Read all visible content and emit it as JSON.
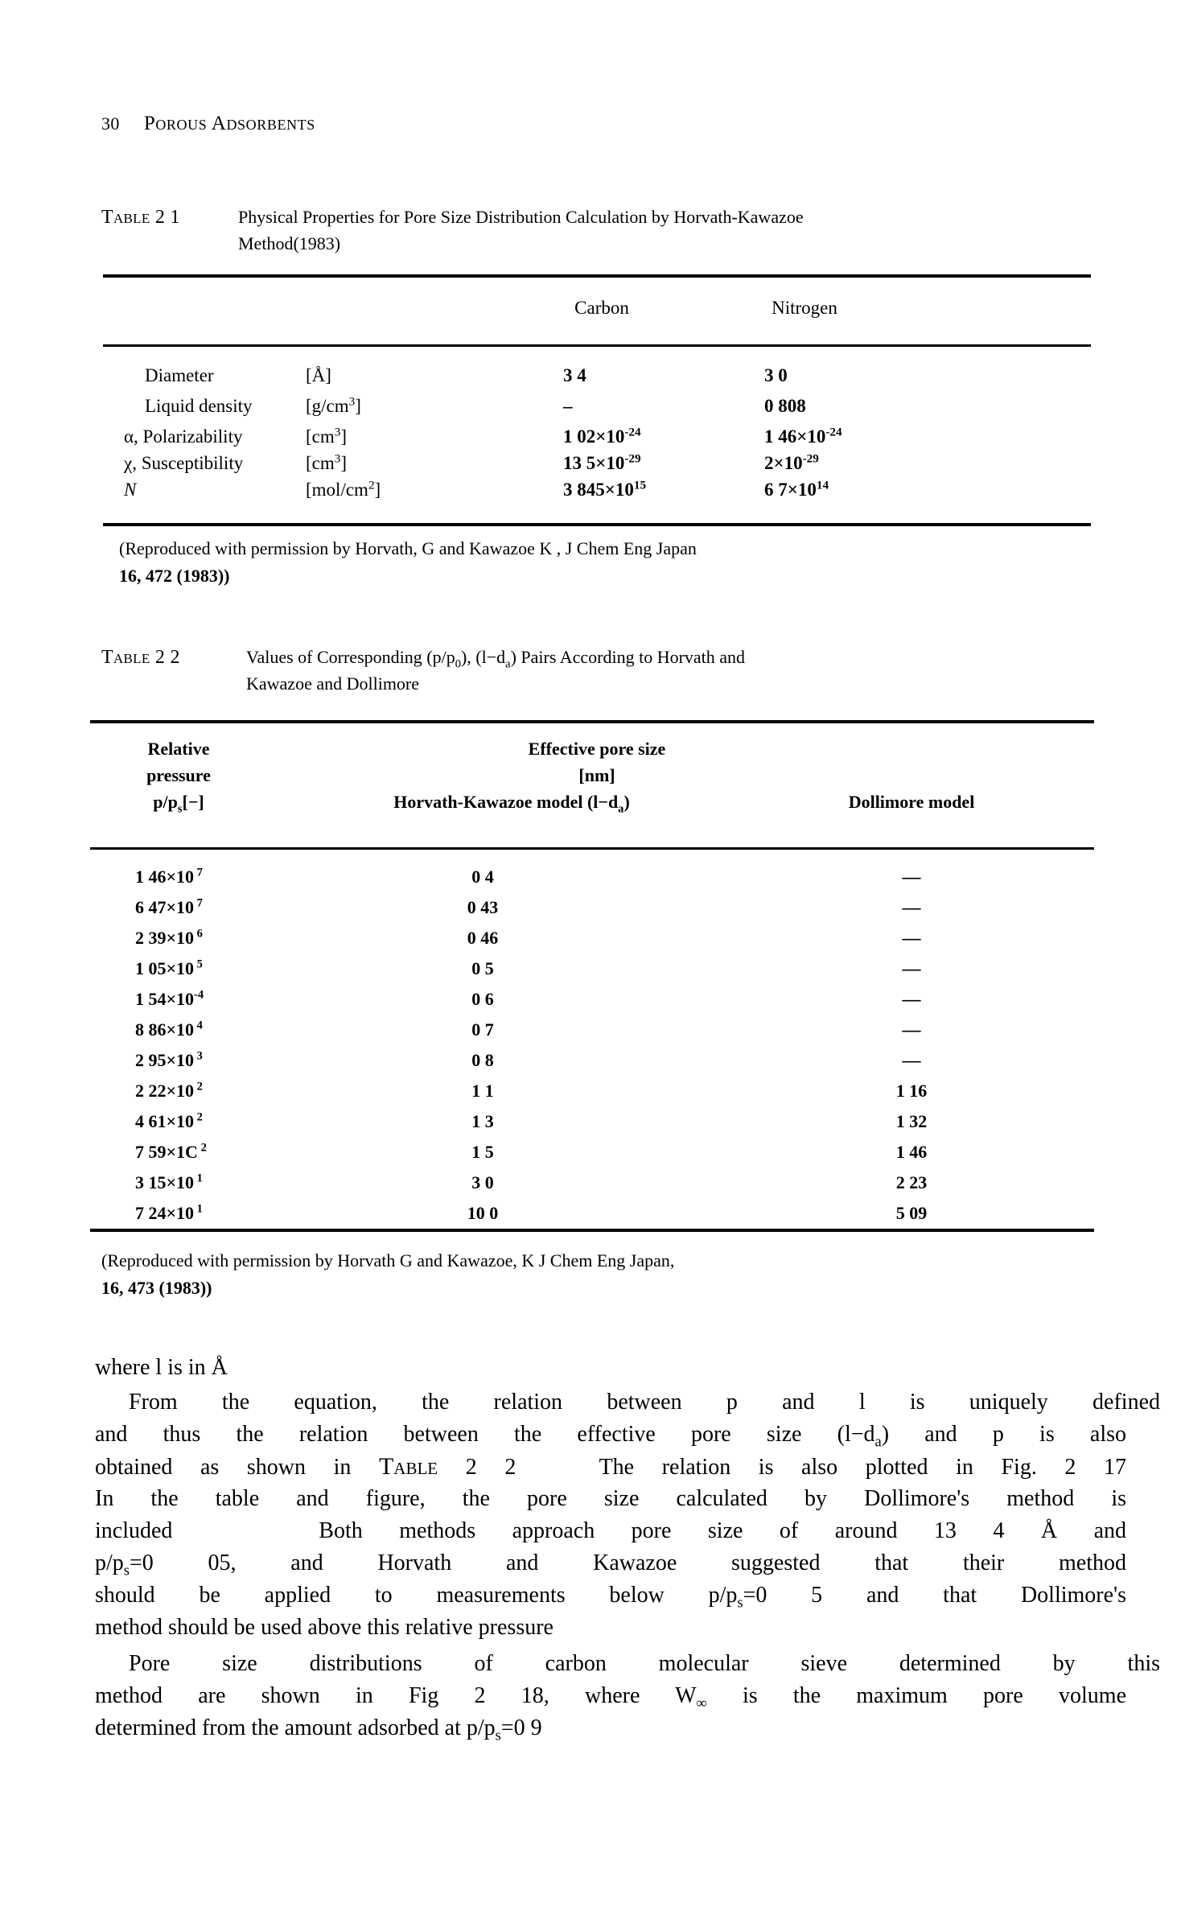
{
  "page": {
    "folio": "30",
    "running_head": "Porous Adsorbents"
  },
  "table21": {
    "caption_label": "Table 2 1",
    "caption_line1": "Physical Properties for Pore Size Distribution Calculation by Horvath-Kawazoe",
    "caption_line2": "Method(1983)",
    "columns": [
      "",
      "",
      "Carbon",
      "Nitrogen"
    ],
    "rows": [
      {
        "property": "Diameter",
        "unit": "[Å]",
        "carbon": "3 4",
        "carbon_exp": "",
        "nitrogen": "3 0",
        "nitrogen_exp": ""
      },
      {
        "property": "Liquid density",
        "unit": "[g/cm³]",
        "carbon": "–",
        "carbon_exp": "",
        "nitrogen": "0 808",
        "nitrogen_exp": ""
      },
      {
        "property": "α, Polarizability",
        "unit": "[cm³]",
        "carbon": "1 02×10",
        "carbon_exp": "-24",
        "nitrogen": "1 46×10",
        "nitrogen_exp": "-24"
      },
      {
        "property": "χ, Susceptibility",
        "unit": "[cm³]",
        "carbon": "13 5×10",
        "carbon_exp": "-29",
        "nitrogen": "2×10",
        "nitrogen_exp": "-29"
      },
      {
        "property": "N",
        "unit": "[mol/cm²]",
        "carbon": "3 845×10",
        "carbon_exp": "15",
        "nitrogen": "6 7×10",
        "nitrogen_exp": "14"
      }
    ],
    "source_note_line1": "(Reproduced with permission by Horvath, G  and Kawazoe K ,",
    "source_note_italic": "J  Chem  Eng  Japan",
    "source_note_line2": "16, 472 (1983))"
  },
  "table22": {
    "caption_label": "Table 2 2",
    "caption_line1_a": "Values of Corresponding (",
    "caption_line1_p": "p/p",
    "caption_line1_sub": "0",
    "caption_line1_b": "), (",
    "caption_line1_l": "l−d",
    "caption_line1_sub2": "a",
    "caption_line1_c": ") Pairs According to Horvath and",
    "caption_line2": "Kawazoe and Dollimore",
    "header_col1_line1": "Relative",
    "header_col1_line2": "pressure",
    "header_col1_line3_a": "p/p",
    "header_col1_line3_sub": "s",
    "header_col1_line3_b": "[−]",
    "header_span_line1": "Effective pore size",
    "header_span_line2": "[nm]",
    "header_col2_a": "Horvath-Kawazoe model (",
    "header_col2_l": "l−d",
    "header_col2_sub": "a",
    "header_col2_b": ")",
    "header_col3": "Dollimore model",
    "rows": [
      {
        "rel_pressure": "1 46×10",
        "rel_exp": " 7",
        "hk": "0 4",
        "dollimore": "—"
      },
      {
        "rel_pressure": "6 47×10",
        "rel_exp": " 7",
        "hk": "0 43",
        "dollimore": "—"
      },
      {
        "rel_pressure": "2 39×10",
        "rel_exp": " 6",
        "hk": "0 46",
        "dollimore": "—"
      },
      {
        "rel_pressure": "1 05×10",
        "rel_exp": " 5",
        "hk": "0 5",
        "dollimore": "—"
      },
      {
        "rel_pressure": "1 54×10",
        "rel_exp": "-4",
        "hk": "0 6",
        "dollimore": "—"
      },
      {
        "rel_pressure": "8 86×10",
        "rel_exp": " 4",
        "hk": "0 7",
        "dollimore": "—"
      },
      {
        "rel_pressure": "2 95×10",
        "rel_exp": " 3",
        "hk": "0 8",
        "dollimore": "—"
      },
      {
        "rel_pressure": "2 22×10",
        "rel_exp": " 2",
        "hk": "1 1",
        "dollimore": "1 16"
      },
      {
        "rel_pressure": "4 61×10",
        "rel_exp": " 2",
        "hk": "1 3",
        "dollimore": "1 32"
      },
      {
        "rel_pressure": "7 59×1C",
        "rel_exp": " 2",
        "hk": "1 5",
        "dollimore": "1 46"
      },
      {
        "rel_pressure": "3 15×10",
        "rel_exp": " 1",
        "hk": "3 0",
        "dollimore": "2 23"
      },
      {
        "rel_pressure": "7 24×10",
        "rel_exp": " 1",
        "hk": "10 0",
        "dollimore": "5 09"
      }
    ],
    "source_note_line1": "(Reproduced with permission by Horvath  G  and Kawazoe, K  ",
    "source_note_italic": "J  Chem  Eng  Japan,",
    "source_note_line2": "16, 473 (1983))"
  },
  "body": {
    "line_where": "where ",
    "line_where_i": "l",
    "line_where_rest": " is in Å",
    "paragraph1": [
      "From the equation, the relation between p and l is uniquely defined",
      "and thus the relation between the effective pore size (l−dₐ) and p is also",
      "obtained as shown in Table 2 2   The relation is also plotted in Fig. 2 17",
      "In the table and figure, the pore size calculated by Dollimore's method is",
      "included    Both methods approach pore size of around 13 4 Å and",
      "p/pₛ=0 05, and Horvath and Kawazoe suggested that their method",
      "should be applied to measurements below p/pₛ=0 5 and that Dollimore's",
      "method should be used above this relative pressure"
    ],
    "paragraph2": [
      "Pore size distributions of carbon molecular sieve determined by this",
      "method are shown in Fig  2 18, where W∞ is the maximum pore volume",
      "determined from the amount adsorbed at p/pₛ=0 9"
    ]
  }
}
